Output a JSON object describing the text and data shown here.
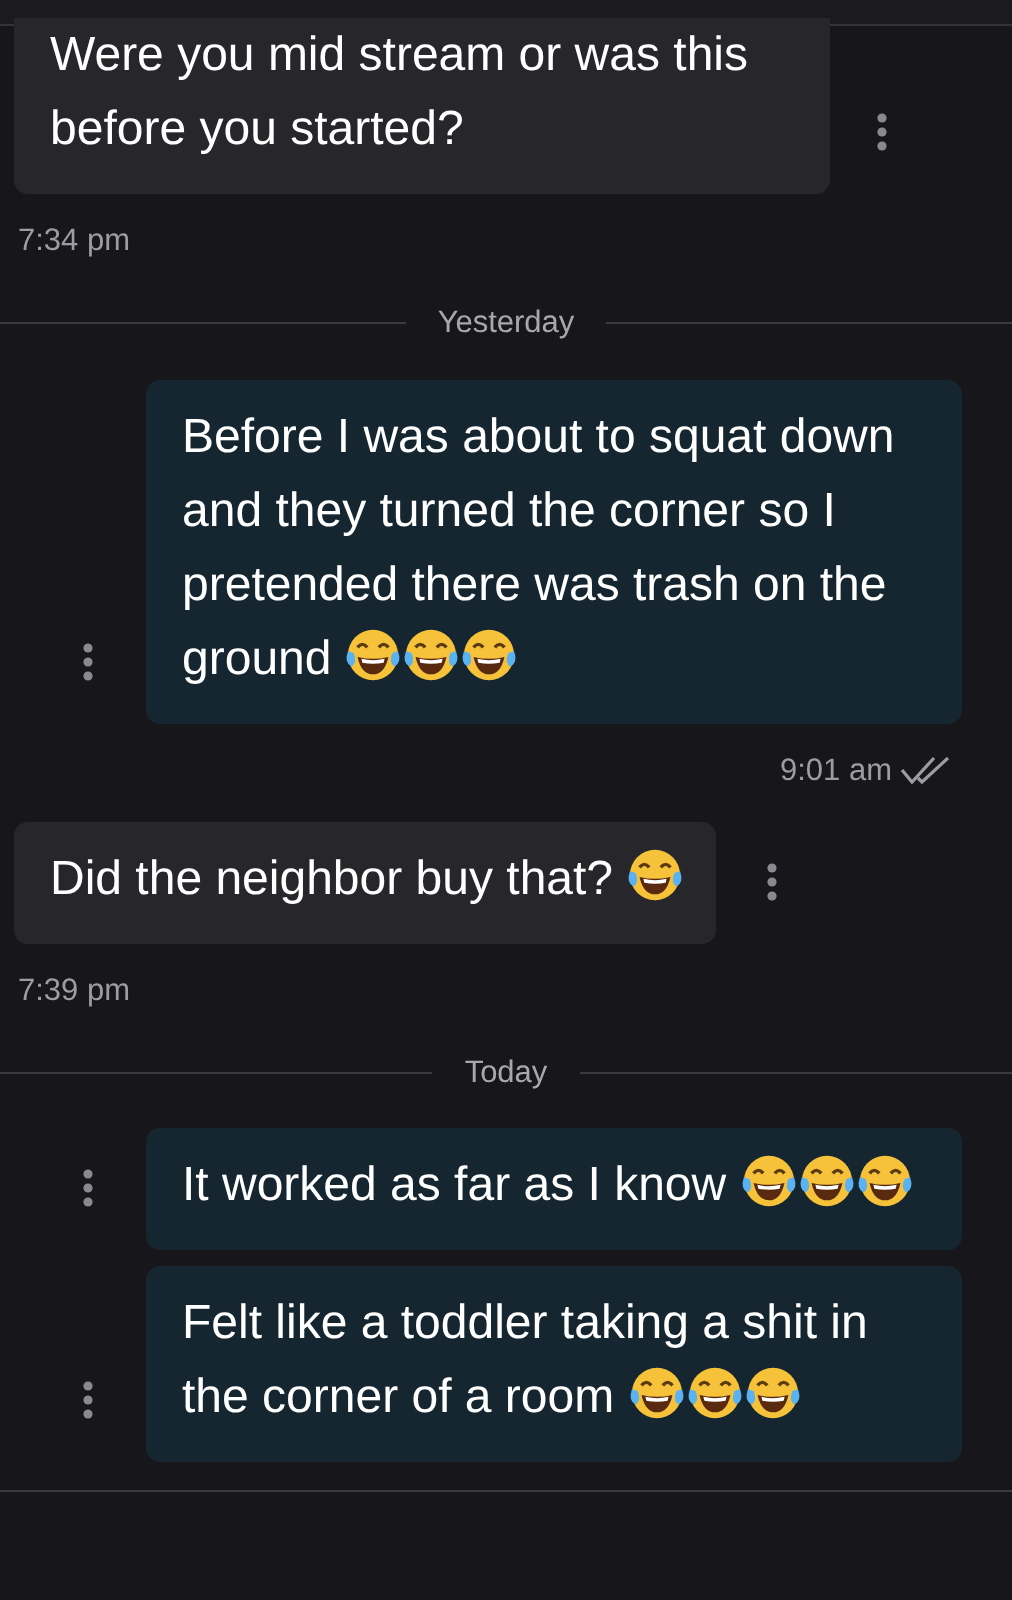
{
  "items": [
    {
      "kind": "incoming",
      "text": "Were you mid stream or was this before you started?",
      "time": "7:34 pm"
    },
    {
      "kind": "divider",
      "text": "Yesterday"
    },
    {
      "kind": "outgoing",
      "text": "Before I was about to squat down and they turned the corner so I pretended there was trash on the ground",
      "emojis": [
        {
          "kind": "tears-of-joy"
        },
        {
          "kind": "tears-of-joy"
        },
        {
          "kind": "tears-of-joy"
        }
      ],
      "time": "9:01 am",
      "read": true
    },
    {
      "kind": "incoming",
      "text": "Did the neighbor buy that?",
      "emojis": [
        {
          "kind": "tears-of-joy"
        }
      ],
      "time": "7:39 pm"
    },
    {
      "kind": "divider",
      "text": "Today"
    },
    {
      "kind": "outgoing",
      "text": "It worked as far as I know",
      "emojis": [
        {
          "kind": "tears-of-joy"
        },
        {
          "kind": "tears-of-joy"
        },
        {
          "kind": "tears-of-joy"
        }
      ]
    },
    {
      "kind": "outgoing",
      "text": "Felt like a toddler taking a shit in the corner of a room",
      "emojis": [
        {
          "kind": "tears-of-joy"
        },
        {
          "kind": "tears-of-joy"
        },
        {
          "kind": "tears-of-joy"
        }
      ]
    }
  ]
}
